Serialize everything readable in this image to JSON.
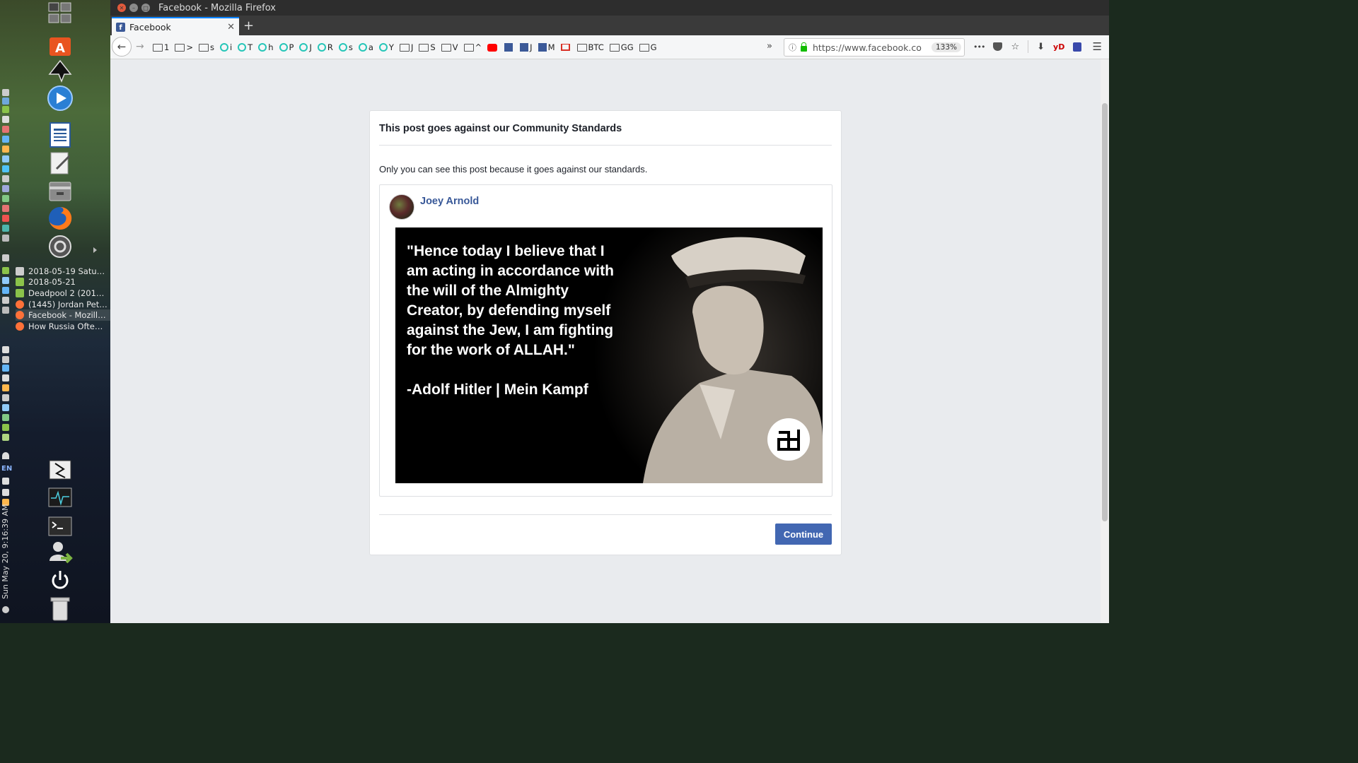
{
  "window": {
    "title": "Facebook - Mozilla Firefox"
  },
  "tab": {
    "label": "Facebook",
    "favicon": "facebook-icon",
    "new_tab_label": "+"
  },
  "toolbar": {
    "back_icon": "back-arrow-icon",
    "forward_icon": "forward-arrow-icon",
    "url": "https://www.facebook.co",
    "zoom": "133%",
    "more_label": "•••",
    "overflow_label": "»",
    "ext_label": "yD"
  },
  "bookmarks": [
    {
      "icon": "folder",
      "label": "1"
    },
    {
      "icon": "folder",
      "label": ">"
    },
    {
      "icon": "folder",
      "label": "s"
    },
    {
      "icon": "ring",
      "label": "i"
    },
    {
      "icon": "ring",
      "label": "T"
    },
    {
      "icon": "ring",
      "label": "h"
    },
    {
      "icon": "ring",
      "label": "P"
    },
    {
      "icon": "ring",
      "label": "J"
    },
    {
      "icon": "ring",
      "label": "R"
    },
    {
      "icon": "ring",
      "label": "s"
    },
    {
      "icon": "ring",
      "label": "a"
    },
    {
      "icon": "ring",
      "label": "Y"
    },
    {
      "icon": "folder",
      "label": "J"
    },
    {
      "icon": "folder",
      "label": "S"
    },
    {
      "icon": "folder",
      "label": "V"
    },
    {
      "icon": "folder",
      "label": "^"
    },
    {
      "icon": "yt",
      "label": ""
    },
    {
      "icon": "fb",
      "label": ""
    },
    {
      "icon": "fb",
      "label": "J"
    },
    {
      "icon": "fb",
      "label": "M"
    },
    {
      "icon": "gm",
      "label": ""
    },
    {
      "icon": "folder",
      "label": "BTC"
    },
    {
      "icon": "folder",
      "label": "GG"
    },
    {
      "icon": "folder",
      "label": "G"
    }
  ],
  "dialog": {
    "title": "This post goes against our Community Standards",
    "message": "Only you can see this post because it goes against our standards.",
    "post": {
      "author": "Joey Arnold",
      "quote": "\"Hence today I believe that I\nam acting in accordance with\nthe will of the Almighty\nCreator, by defending myself\nagainst the Jew, I am fighting\nfor the work of ALLAH.\"",
      "attribution": "-Adolf Hitler | Mein Kampf"
    },
    "continue_label": "Continue"
  },
  "desktop": {
    "windows": [
      {
        "label": "2018-05-19 Satur…",
        "icon_color": "#cccccc"
      },
      {
        "label": "2018-05-21",
        "icon_color": "#8bc34a"
      },
      {
        "label": "Deadpool 2 (2018…",
        "icon_color": "#8bc34a"
      },
      {
        "label": "(1445) Jordan Pet…",
        "icon_color": "#ff7139"
      },
      {
        "label": "Facebook - Mozill…",
        "icon_color": "#ff7139"
      },
      {
        "label": "How Russia Ofte…",
        "icon_color": "#ff7139"
      }
    ],
    "language": "EN",
    "clock": "Sun May 20,  9:16:39 AM"
  }
}
